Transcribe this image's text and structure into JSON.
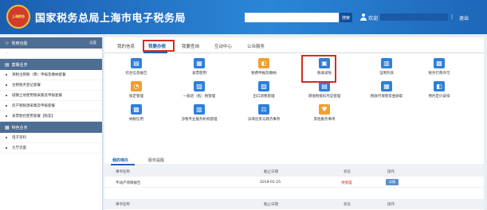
{
  "header": {
    "logo_text": "上海税务",
    "title": "国家税务总局上海市电子税务局",
    "search_placeholder": "",
    "search_button": "搜索",
    "welcome": "欢迎",
    "user_name": "",
    "separator": "|",
    "logout": "退出"
  },
  "sidebar": {
    "sections": [
      {
        "title": "常用功能",
        "action": "设置",
        "items": [
          {
            "label": "--",
            "empty": true
          }
        ]
      },
      {
        "title": "套餐业务",
        "items": [
          {
            "label": "清税注销税（费）申报及缴纳套餐"
          },
          {
            "label": "注销税务登记套餐"
          },
          {
            "label": "城镇土地使用税采集及申报套餐"
          },
          {
            "label": "房产税税源采集及申报套餐"
          },
          {
            "label": "发票税控使用套餐【税友】"
          }
        ]
      },
      {
        "title": "特色业务",
        "items": [
          {
            "label": "电子资料"
          },
          {
            "label": "大厅流量"
          }
        ]
      }
    ]
  },
  "main": {
    "tabs": [
      "我的信息",
      "我要办税",
      "我要查询",
      "互动中心",
      "公众服务"
    ],
    "active_tab": "我要办税",
    "functions": [
      {
        "label": "综合信息报告",
        "icon": "info-report-icon",
        "color": "#2f7fd8"
      },
      {
        "label": "发票使用",
        "icon": "invoice-icon",
        "color": "#2f7fd8"
      },
      {
        "label": "税费申报及缴纳",
        "icon": "tax-payment-icon",
        "color": "#f0a030"
      },
      {
        "label": "税收减免",
        "icon": "tax-relief-icon",
        "color": "#2f7fd8",
        "highlighted": true
      },
      {
        "label": "证明开具",
        "icon": "certificate-icon",
        "color": "#2f7fd8"
      },
      {
        "label": "税务行政许可",
        "icon": "admin-permit-icon",
        "color": "#2f7fd8"
      },
      {
        "label": "核定管理",
        "icon": "verify-manage-icon",
        "color": "#f0a030"
      },
      {
        "label": "一般退（抵）税管理",
        "icon": "refund-icon",
        "color": "#2f7fd8"
      },
      {
        "label": "出口退税管理",
        "icon": "export-refund-icon",
        "color": "#2f7fd8"
      },
      {
        "label": "增值税抵扣凭证管理",
        "icon": "vat-deduction-icon",
        "color": "#2f7fd8"
      },
      {
        "label": "税收代保管资金收取",
        "icon": "fund-custody-icon",
        "color": "#2f7fd8"
      },
      {
        "label": "预约定价安排",
        "icon": "pricing-icon",
        "color": "#2f7fd8"
      },
      {
        "label": "纳税信用",
        "icon": "tax-credit-icon",
        "color": "#2f7fd8"
      },
      {
        "label": "涉税专业服务机构管理",
        "icon": "agency-manage-icon",
        "color": "#2f7fd8"
      },
      {
        "label": "法律追责与救济事项",
        "icon": "legal-relief-icon",
        "color": "#2f7fd8"
      },
      {
        "label": "其他服务事项",
        "icon": "other-service-icon",
        "color": "#f0a030"
      }
    ],
    "todo": {
      "tabs": [
        "我的待办",
        "服务提醒"
      ],
      "columns": [
        "事项名称",
        "截止日期",
        "状态",
        "操作"
      ],
      "rows": [
        {
          "name": "不动产项目报告",
          "deadline": "2019-01-25",
          "status": "待受理",
          "action": "详情"
        }
      ]
    }
  }
}
